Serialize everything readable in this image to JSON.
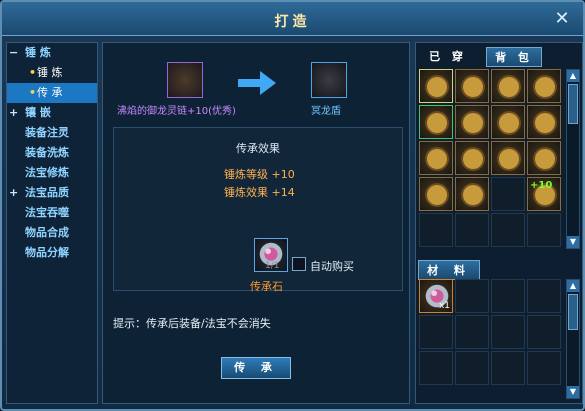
{
  "window": {
    "title": "打造",
    "close_icon": "close-icon"
  },
  "nav": {
    "items": [
      {
        "kind": "group",
        "expanded": true,
        "label": "锤  炼"
      },
      {
        "kind": "sub",
        "label": "锤 炼",
        "active": false
      },
      {
        "kind": "sub",
        "label": "传 承",
        "active": true
      },
      {
        "kind": "group",
        "expanded": false,
        "label": "镶  嵌"
      },
      {
        "kind": "item",
        "label": "装备注灵"
      },
      {
        "kind": "item",
        "label": "装备洗炼"
      },
      {
        "kind": "item",
        "label": "法宝修炼"
      },
      {
        "kind": "group",
        "expanded": false,
        "label": "法宝品质"
      },
      {
        "kind": "item",
        "label": "法宝吞噬"
      },
      {
        "kind": "item",
        "label": "物品合成"
      },
      {
        "kind": "item",
        "label": "物品分解"
      }
    ]
  },
  "inherit": {
    "source_item": {
      "name": "沸焰的御龙灵链+10(优秀)",
      "color": "#c889ff"
    },
    "target_item": {
      "name": "冥龙盾",
      "color": "#6fc7ff"
    },
    "arrow_icon": "arrow-right-icon",
    "effect_title": "传承效果",
    "effect_lines": [
      "锤炼等级 +10",
      "锤炼效果 +14"
    ],
    "stone": {
      "count": "1/1",
      "label": "传承石",
      "icon": "stone-icon"
    },
    "auto_buy_label": "自动购买",
    "tip": "提示：传承后装备/法宝不会消失",
    "action_button_label": "传  承"
  },
  "right": {
    "tabs": [
      "已 穿",
      "背 包"
    ],
    "active_tab": 1,
    "inventory": [
      {
        "icon": "chain-icon",
        "selected": true
      },
      {
        "icon": "dragon-shield-icon"
      },
      {
        "icon": "dragon-helmet-icon"
      },
      {
        "icon": "dragon-helmet-icon"
      },
      {
        "icon": "sword-icon",
        "green": true
      },
      {
        "icon": "dragon-armor-icon"
      },
      {
        "icon": "dragon-armor-icon"
      },
      {
        "icon": "dragon-belt-icon"
      },
      {
        "icon": "dragon-helmet-icon"
      },
      {
        "icon": "dragon-armor-icon"
      },
      {
        "icon": "bead-necklace-icon"
      },
      {
        "icon": "flower-vase-icon"
      },
      {
        "icon": "green-spike-icon"
      },
      {
        "icon": "chain-icon"
      },
      null,
      {
        "icon": "chain-icon",
        "badge": "+10"
      }
    ],
    "materials_tab": "材 料",
    "materials": [
      {
        "icon": "stone-icon",
        "count": "x1"
      }
    ]
  }
}
